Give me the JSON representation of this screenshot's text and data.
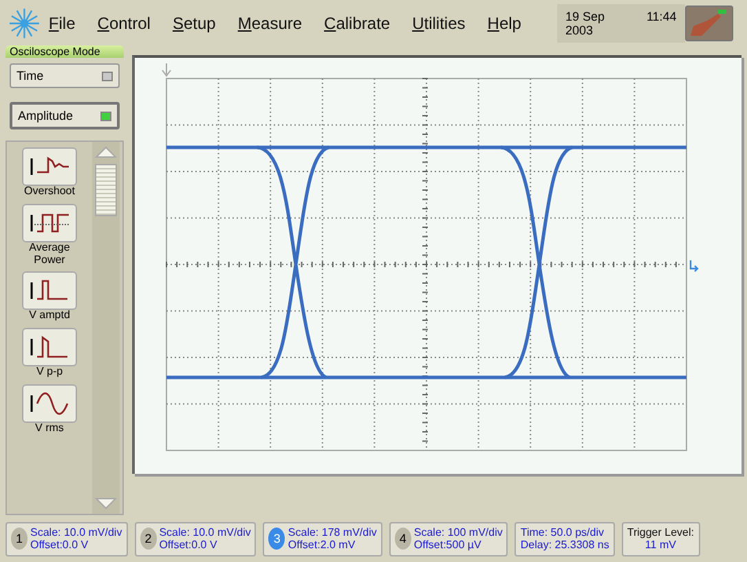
{
  "menu": [
    "File",
    "Control",
    "Setup",
    "Measure",
    "Calibrate",
    "Utilities",
    "Help"
  ],
  "clock": {
    "date": "19 Sep 2003",
    "time": "11:44"
  },
  "mode_tab": "Osciloscope Mode",
  "mode_buttons": [
    {
      "label": "Time",
      "on": false
    },
    {
      "label": "Amplitude",
      "on": true
    }
  ],
  "measurements": [
    {
      "kind": "overshoot",
      "label": "Overshoot"
    },
    {
      "kind": "power",
      "label": "Average Power"
    },
    {
      "kind": "amplitude",
      "label": "V amptd"
    },
    {
      "kind": "peak",
      "label": "V p-p"
    },
    {
      "kind": "rms",
      "label": "V rms"
    }
  ],
  "channels": [
    {
      "number": "1",
      "selected": false,
      "scale": "Scale: 10.0 mV/div",
      "offset": "Offset:0.0 V"
    },
    {
      "number": "2",
      "selected": false,
      "scale": "Scale: 10.0 mV/div",
      "offset": "Offset:0.0 V"
    },
    {
      "number": "3",
      "selected": true,
      "scale": "Scale: 178 mV/div",
      "offset": "Offset:2.0 mV"
    },
    {
      "number": "4",
      "selected": false,
      "scale": "Scale: 100 mV/div",
      "offset": "Offset:500 µV"
    }
  ],
  "timebase": {
    "time": "Time: 50.0 ps/div",
    "delay": "Delay: 25.3308 ns"
  },
  "trigger": {
    "label": "Trigger Level:",
    "value": "11 mV"
  }
}
